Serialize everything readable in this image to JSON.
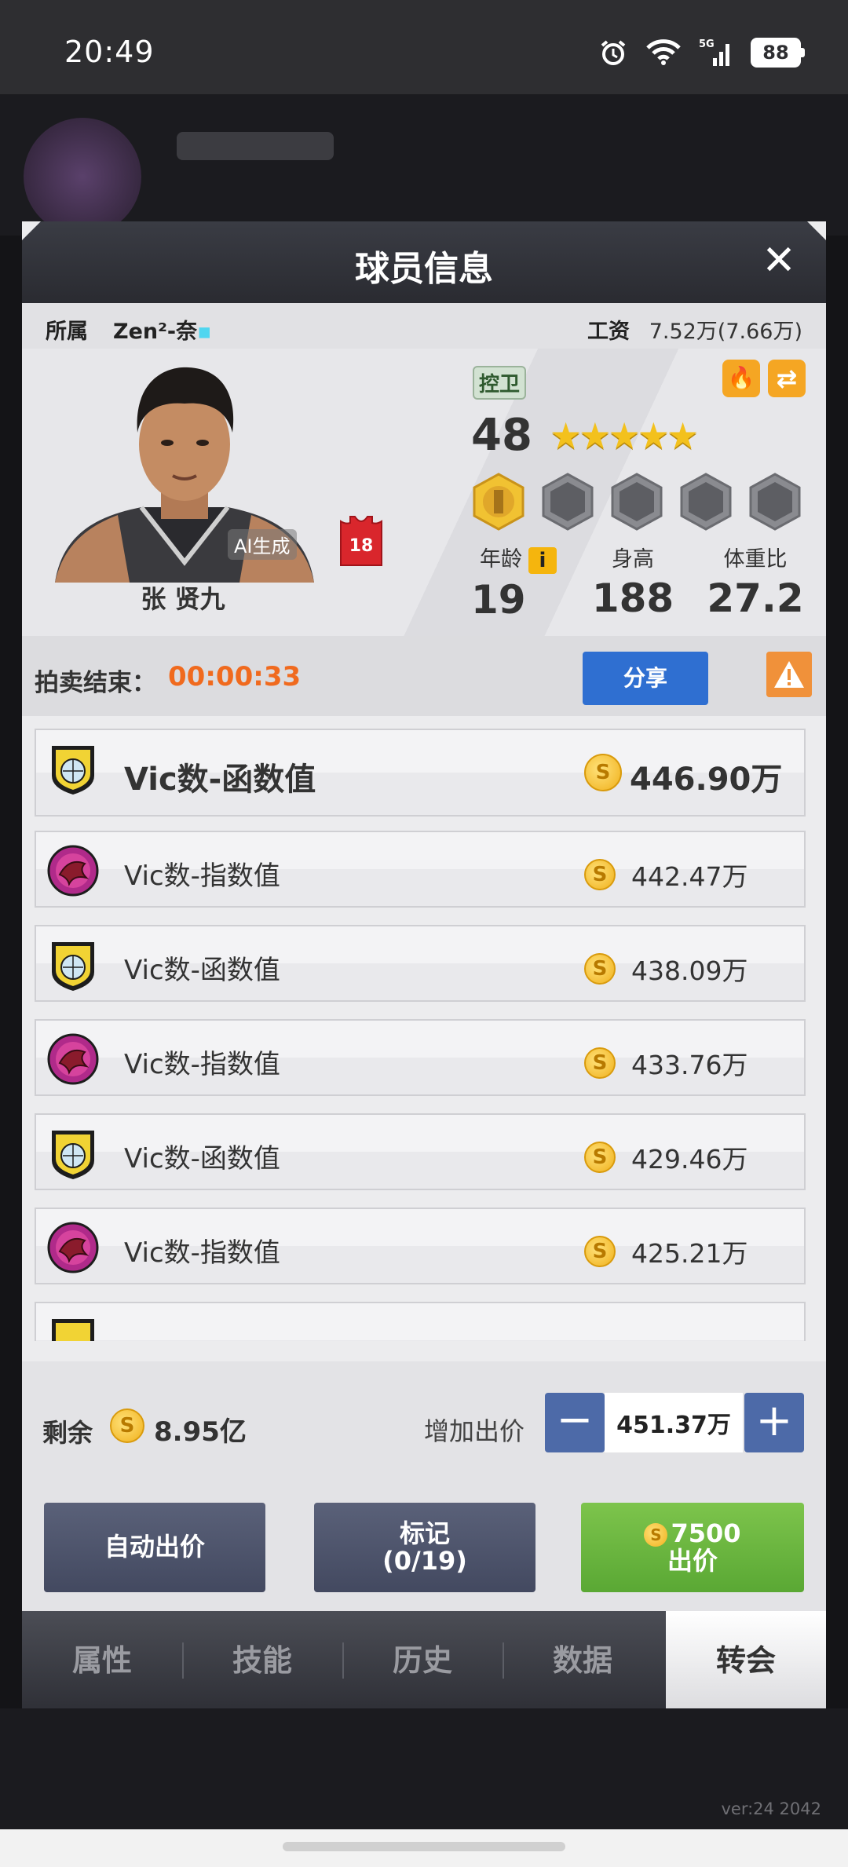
{
  "status": {
    "time": "20:49",
    "battery": "88",
    "network": "5G"
  },
  "modal": {
    "title": "球员信息",
    "close": "✕"
  },
  "info": {
    "team_label": "所属",
    "team_name": "Zen²-奈",
    "team_dot": "▪",
    "salary_label": "工资",
    "salary_value": "7.52万(7.66万)"
  },
  "player": {
    "name": "张 贤九",
    "ai_label": "AI生成",
    "jersey_number": "18",
    "position": "控卫",
    "rating": "48",
    "stars": "★★★★★",
    "stats": [
      {
        "label": "年龄",
        "value": "19"
      },
      {
        "label": "身高",
        "value": "188"
      },
      {
        "label": "体重比",
        "value": "27.2"
      }
    ]
  },
  "auction": {
    "label": "拍卖结束：",
    "timer": "00:00:33",
    "share": "分享"
  },
  "bids": [
    {
      "team": "Vic数-函数值",
      "amount": "446.90万",
      "logo": "shield-logo"
    },
    {
      "team": "Vic数-指数值",
      "amount": "442.47万",
      "logo": "dragon-logo"
    },
    {
      "team": "Vic数-函数值",
      "amount": "438.09万",
      "logo": "shield-logo"
    },
    {
      "team": "Vic数-指数值",
      "amount": "433.76万",
      "logo": "dragon-logo"
    },
    {
      "team": "Vic数-函数值",
      "amount": "429.46万",
      "logo": "shield-logo"
    },
    {
      "team": "Vic数-指数值",
      "amount": "425.21万",
      "logo": "dragon-logo"
    }
  ],
  "bottom": {
    "remain_label": "剩余",
    "remain_value": "8.95亿",
    "increase_label": "增加出价",
    "bid_input": "451.37万",
    "auto_bid": "自动出价",
    "mark_line1": "标记",
    "mark_line2": "(0/19)",
    "bid_cost": "7500",
    "bid_label": "出价",
    "coin_glyph": "S"
  },
  "tabs": [
    "属性",
    "技能",
    "历史",
    "数据",
    "转会"
  ],
  "version": "ver:24  2042"
}
